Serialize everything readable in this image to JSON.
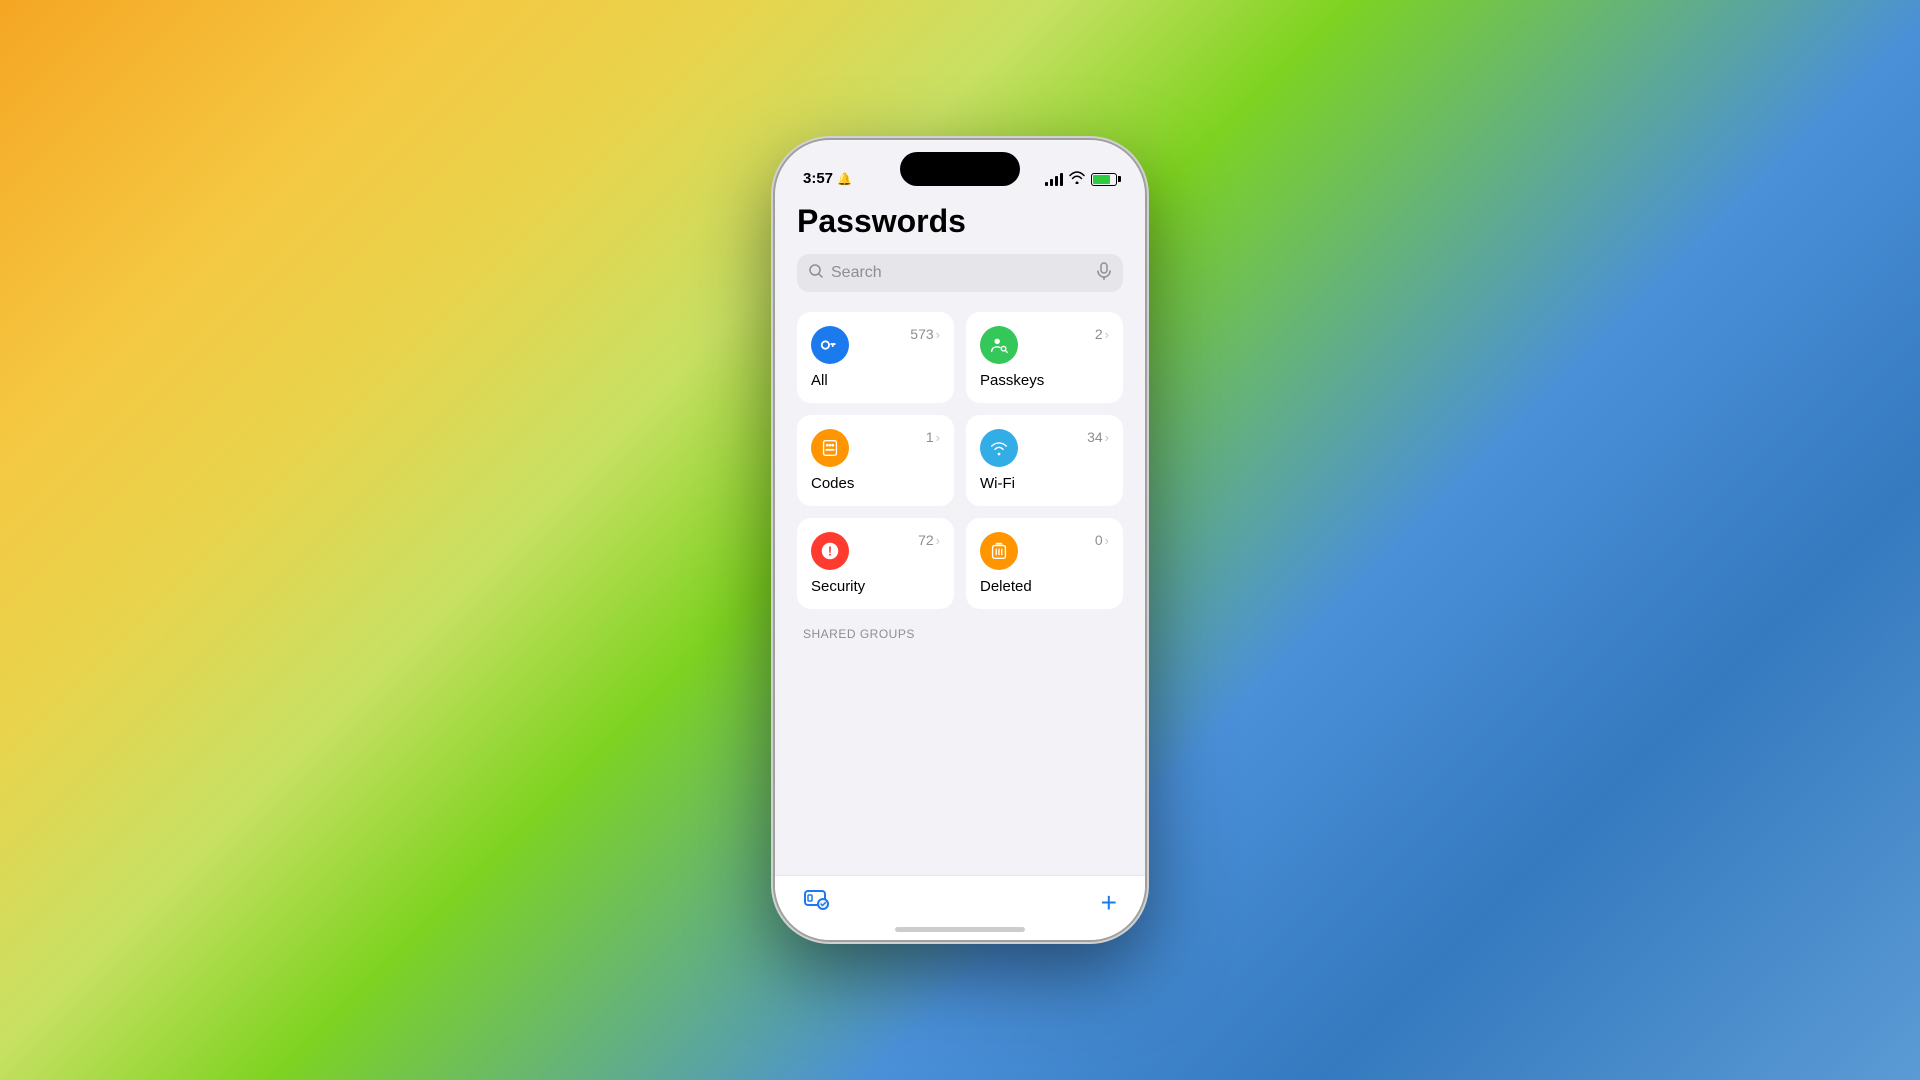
{
  "background": {
    "colors": [
      "#f5a623",
      "#7ed321",
      "#4a90d9"
    ]
  },
  "statusBar": {
    "time": "3:57",
    "alarm": true,
    "batteryLevel": 75
  },
  "page": {
    "title": "Passwords",
    "searchPlaceholder": "Search"
  },
  "cards": [
    {
      "id": "all",
      "label": "All",
      "count": "573",
      "iconType": "blue",
      "iconName": "key-icon"
    },
    {
      "id": "passkeys",
      "label": "Passkeys",
      "count": "2",
      "iconType": "green",
      "iconName": "passkey-icon"
    },
    {
      "id": "codes",
      "label": "Codes",
      "count": "1",
      "iconType": "yellow",
      "iconName": "code-icon"
    },
    {
      "id": "wifi",
      "label": "Wi-Fi",
      "count": "34",
      "iconType": "cyan",
      "iconName": "wifi-icon"
    },
    {
      "id": "security",
      "label": "Security",
      "count": "72",
      "iconType": "red",
      "iconName": "security-icon"
    },
    {
      "id": "deleted",
      "label": "Deleted",
      "count": "0",
      "iconType": "orange",
      "iconName": "deleted-icon"
    }
  ],
  "sections": [
    {
      "id": "shared-groups",
      "label": "SHARED GROUPS"
    }
  ],
  "bottomBar": {
    "tabIcon": "passwords-tab",
    "addButton": "+"
  }
}
